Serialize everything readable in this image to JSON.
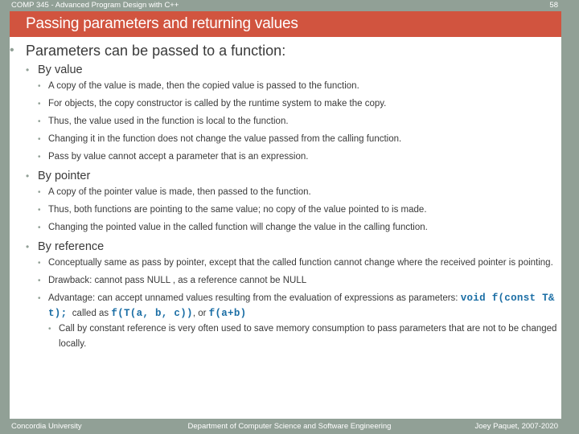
{
  "colors": {
    "frame": "#91a096",
    "title_band": "#d1543f",
    "code": "#1b6ea5",
    "body_text": "#3a3a3a",
    "header_text": "#ffffff"
  },
  "header": {
    "course": "COMP 345 - Advanced Program Design with C++",
    "slide_number": "58"
  },
  "title": "Passing parameters and returning values",
  "content": {
    "main_bullet": "Parameters can be passed to a function:",
    "sections": [
      {
        "heading": "By value",
        "items": [
          "A copy of the value is made, then the copied value is passed to the function.",
          "For objects, the copy constructor is called by the runtime system to make the copy.",
          "Thus, the value used in the function is local to the function.",
          "Changing it in the function does not change the value passed from the calling function.",
          "Pass by value cannot accept a parameter that is an expression."
        ]
      },
      {
        "heading": "By pointer",
        "items": [
          "A copy of the pointer value is made, then passed to the function.",
          "Thus, both functions are pointing to the same value; no copy of the value pointed to is made.",
          "Changing the pointed value in the called function will change the value in the calling function."
        ]
      },
      {
        "heading": "By reference",
        "items": [
          "Conceptually same as pass by pointer, except that the called function cannot change where the received pointer is pointing.",
          "Drawback: cannot pass NULL , as a reference cannot be NULL"
        ],
        "advantage": {
          "text_before": "Advantage: can accept unnamed values resulting from the evaluation of expressions as parameters:",
          "code_1": "void f(const T& t);",
          "text_middle": "called as",
          "code_2": "f(T(a, b, c))",
          "text_after": ", or",
          "code_3": "f(a+b)"
        },
        "sub_items": [
          "Call by constant reference is very often used to save memory consumption to pass parameters that are not to be changed locally."
        ]
      }
    ]
  },
  "footer": {
    "left": "Concordia University",
    "center": "Department of Computer Science and Software Engineering",
    "right": "Joey Paquet, 2007-2020"
  },
  "icons": {
    "bullet": "•"
  }
}
